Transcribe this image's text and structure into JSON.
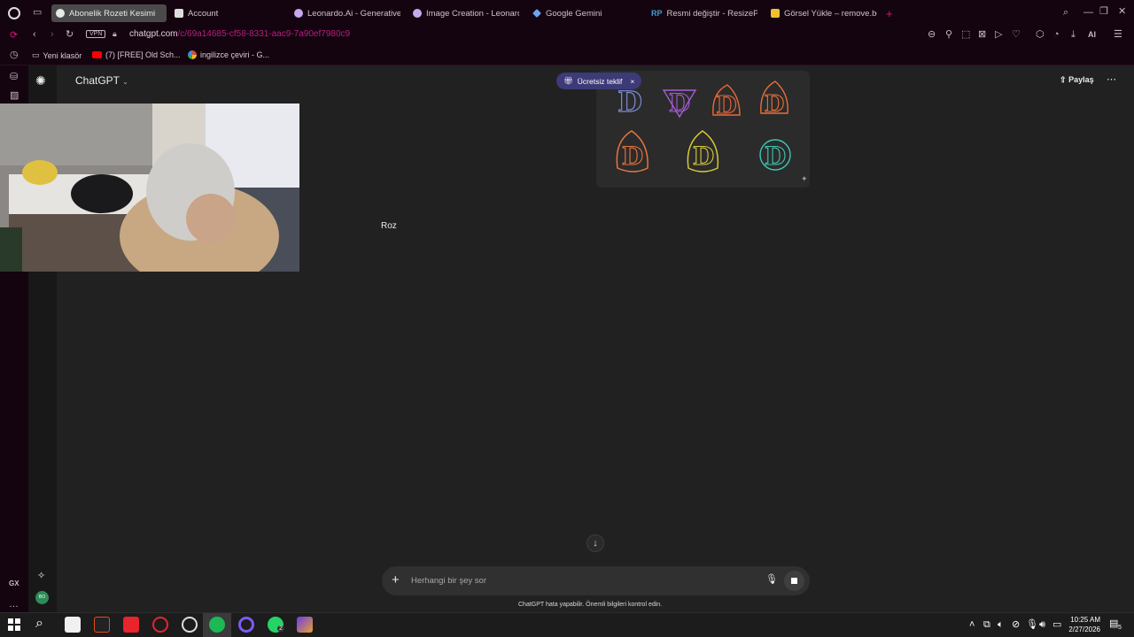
{
  "browser": {
    "tabs": [
      {
        "label": "Abonelik Rozeti Kesimi",
        "active": true
      },
      {
        "label": "Account",
        "active": false
      },
      {
        "label": "Leonardo.Ai - Generative",
        "active": false
      },
      {
        "label": "Image Creation - Leonard",
        "active": false
      },
      {
        "label": "Google Gemini",
        "active": false
      },
      {
        "label": "Resmi değiştir - ResizePix",
        "active": false
      },
      {
        "label": "Görsel Yükle – remove.bg",
        "active": false
      }
    ],
    "vpn_label": "VPN",
    "url_host": "chatgpt.com",
    "url_path": "/c/69a14685-cf58-8331-aac9-7a90ef7980c9",
    "ai_label": "AI",
    "bookmarks": [
      {
        "label": "Yeni klasör"
      },
      {
        "label": "(7) [FREE] Old Sch..."
      },
      {
        "label": "ingilizce çeviri - G..."
      }
    ],
    "gx_label": "GX",
    "accent_color": "#d6157f"
  },
  "chatgpt": {
    "model_label": "ChatGPT",
    "share_label": "Paylaş",
    "promo_label": "Ücretsiz teklif",
    "user_message": "Roz",
    "composer_placeholder": "Herhangi bir şey sor",
    "disclaimer": "ChatGPT hata yapabilir. Önemli bilgileri kontrol edin.",
    "avatar_initials": "BO",
    "badge_colors": [
      "#7a8bd0",
      "#a65cd8",
      "#e86a3a",
      "#e6703a",
      "#e8773e",
      "#d8c83a",
      "#3ec8b4"
    ]
  },
  "taskbar": {
    "time": "10:25 AM",
    "date": "2/27/2026",
    "notification_count": "5",
    "whatsapp_count": "2"
  }
}
